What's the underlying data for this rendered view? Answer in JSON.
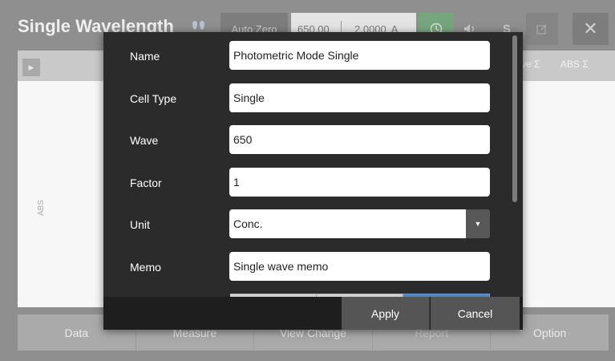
{
  "app": {
    "title": "Single Wavelength",
    "auto_zero_label": "Auto Zero",
    "wavelength_value": "650.00",
    "absorbance_value": "2.0000",
    "absorbance_unit": "A",
    "s_label": "S",
    "colors": {
      "accent_green": "#77a67e",
      "accent_blue": "#4b86c5"
    }
  },
  "table": {
    "columns": [
      "ve Σ",
      "ABS Σ"
    ],
    "axis_label": "ABS"
  },
  "bottom_nav": {
    "items": [
      "Data",
      "Measure",
      "View Change",
      "Report",
      "Option"
    ]
  },
  "dialog": {
    "fields": [
      {
        "label": "Name",
        "value": "Photometric Mode Single"
      },
      {
        "label": "Cell Type",
        "value": "Single"
      },
      {
        "label": "Wave",
        "value": "650"
      },
      {
        "label": "Factor",
        "value": "1"
      },
      {
        "label": "Unit",
        "value": "Conc."
      },
      {
        "label": "Memo",
        "value": "Single wave memo"
      }
    ],
    "apply_label": "Apply",
    "cancel_label": "Cancel"
  }
}
